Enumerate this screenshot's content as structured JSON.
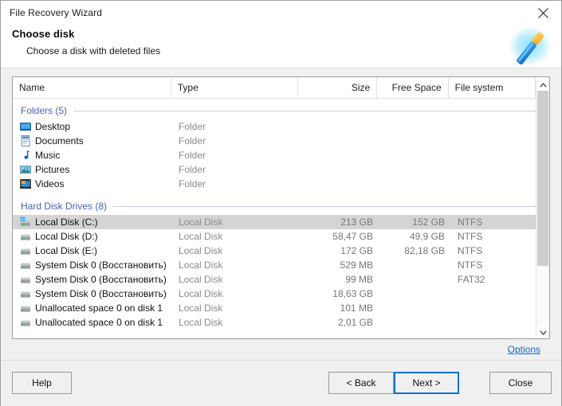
{
  "window": {
    "title": "File Recovery Wizard",
    "close_icon": "close-x-icon"
  },
  "header": {
    "title": "Choose disk",
    "subtitle": "Choose a disk with deleted files",
    "icon": "magic-wand-icon"
  },
  "list": {
    "columns": [
      {
        "key": "name",
        "label": "Name"
      },
      {
        "key": "type",
        "label": "Type"
      },
      {
        "key": "size",
        "label": "Size"
      },
      {
        "key": "free",
        "label": "Free Space"
      },
      {
        "key": "fs",
        "label": "File system"
      }
    ],
    "groups": [
      {
        "label": "Folders (5)",
        "rows": [
          {
            "icon": "desktop-icon",
            "name": "Desktop",
            "type": "Folder",
            "size": "",
            "free": "",
            "fs": "",
            "selected": false
          },
          {
            "icon": "documents-icon",
            "name": "Documents",
            "type": "Folder",
            "size": "",
            "free": "",
            "fs": "",
            "selected": false
          },
          {
            "icon": "music-icon",
            "name": "Music",
            "type": "Folder",
            "size": "",
            "free": "",
            "fs": "",
            "selected": false
          },
          {
            "icon": "pictures-icon",
            "name": "Pictures",
            "type": "Folder",
            "size": "",
            "free": "",
            "fs": "",
            "selected": false
          },
          {
            "icon": "videos-icon",
            "name": "Videos",
            "type": "Folder",
            "size": "",
            "free": "",
            "fs": "",
            "selected": false
          }
        ]
      },
      {
        "label": "Hard Disk Drives (8)",
        "rows": [
          {
            "icon": "system-drive-icon",
            "name": "Local Disk (C:)",
            "type": "Local Disk",
            "size": "213 GB",
            "free": "152 GB",
            "fs": "NTFS",
            "selected": true
          },
          {
            "icon": "drive-icon",
            "name": "Local Disk (D:)",
            "type": "Local Disk",
            "size": "58,47 GB",
            "free": "49,9 GB",
            "fs": "NTFS",
            "selected": false
          },
          {
            "icon": "drive-icon",
            "name": "Local Disk (E:)",
            "type": "Local Disk",
            "size": "172 GB",
            "free": "82,18 GB",
            "fs": "NTFS",
            "selected": false
          },
          {
            "icon": "drive-icon",
            "name": "System Disk 0 (Восстановить)",
            "type": "Local Disk",
            "size": "529 MB",
            "free": "",
            "fs": "NTFS",
            "selected": false
          },
          {
            "icon": "drive-icon",
            "name": "System Disk 0 (Восстановить)",
            "type": "Local Disk",
            "size": "99 MB",
            "free": "",
            "fs": "FAT32",
            "selected": false
          },
          {
            "icon": "drive-icon",
            "name": "System Disk 0 (Восстановить)",
            "type": "Local Disk",
            "size": "18,63 GB",
            "free": "",
            "fs": "",
            "selected": false
          },
          {
            "icon": "drive-icon",
            "name": "Unallocated space 0 on disk 1",
            "type": "Local Disk",
            "size": "101 MB",
            "free": "",
            "fs": "",
            "selected": false
          },
          {
            "icon": "drive-icon",
            "name": "Unallocated space 0 on disk 1",
            "type": "Local Disk",
            "size": "2,01 GB",
            "free": "",
            "fs": "",
            "selected": false
          }
        ]
      }
    ],
    "scrollbar": {
      "up_icon": "chevron-up-icon",
      "down_icon": "chevron-down-icon"
    }
  },
  "options": {
    "label": "Options"
  },
  "footer": {
    "help_label": "Help",
    "back_label": "< Back",
    "next_label": "Next >",
    "close_label": "Close"
  },
  "colors": {
    "accent": "#0a72d4",
    "link": "#1266c9",
    "group_text": "#4a62b4",
    "selection": "#d4d4d4"
  }
}
